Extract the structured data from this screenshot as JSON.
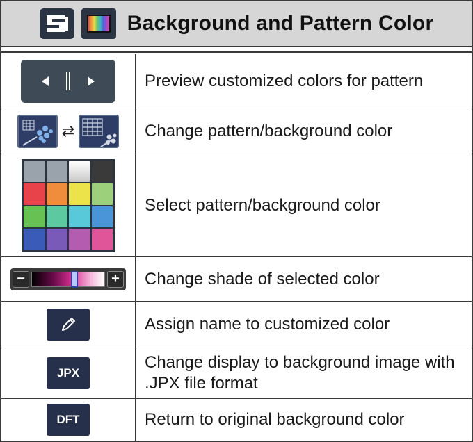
{
  "header": {
    "title": "Background and Pattern Color",
    "icons": [
      "machine-icon",
      "color-palette-icon"
    ]
  },
  "rows": [
    {
      "icon": "preview-play-control-icon",
      "text": "Preview customized colors for pattern"
    },
    {
      "icon": "pattern-background-swap-icon",
      "text": "Change pattern/background color"
    },
    {
      "icon": "color-palette-grid",
      "text": "Select pattern/background color",
      "palette_colors": [
        "#9aa3ab",
        "#9aa3ab",
        "#f3f3f3",
        "#3a3a3a",
        "#e8434b",
        "#ef8d3d",
        "#ece24a",
        "#9cd07a",
        "#67c153",
        "#5cc9a0",
        "#58c9d8",
        "#4a95d8",
        "#3a5cb8",
        "#7a5ab8",
        "#b35cb0",
        "#e0559a"
      ]
    },
    {
      "icon": "shade-slider",
      "text": "Change shade of selected color",
      "minus_label": "−",
      "plus_label": "+"
    },
    {
      "icon": "pencil-icon",
      "text": "Assign name to customized color"
    },
    {
      "icon": "jpx-button",
      "text": "Change display to background image with .JPX file format",
      "button_label": "JPX"
    },
    {
      "icon": "dft-button",
      "text": "Return to original background color",
      "button_label": "DFT"
    }
  ]
}
